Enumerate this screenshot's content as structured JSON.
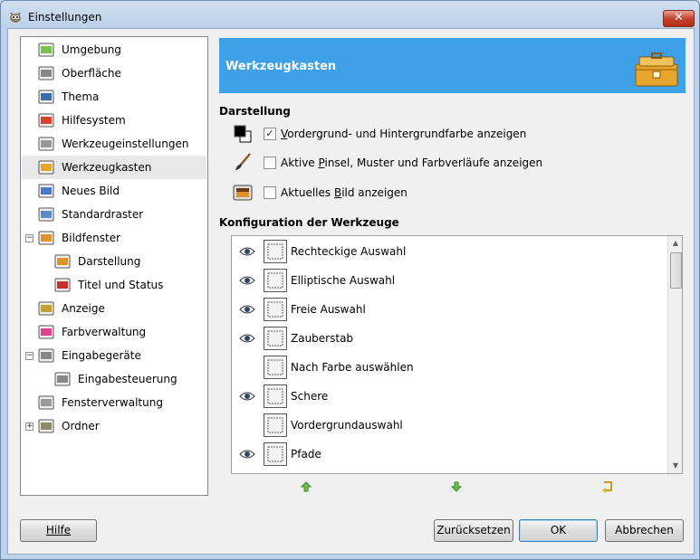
{
  "window": {
    "title": "Einstellungen",
    "close_label": "✕"
  },
  "sidebar": {
    "items": [
      {
        "label": "Umgebung",
        "icon": "environment-icon"
      },
      {
        "label": "Oberfläche",
        "icon": "interface-icon"
      },
      {
        "label": "Thema",
        "icon": "theme-icon"
      },
      {
        "label": "Hilfesystem",
        "icon": "help-system-icon"
      },
      {
        "label": "Werkzeugeinstellungen",
        "icon": "tool-options-icon"
      },
      {
        "label": "Werkzeugkasten",
        "icon": "toolbox-icon",
        "selected": true
      },
      {
        "label": "Neues Bild",
        "icon": "new-image-icon"
      },
      {
        "label": "Standardraster",
        "icon": "default-grid-icon"
      },
      {
        "label": "Bildfenster",
        "icon": "image-window-icon",
        "expander": "−"
      },
      {
        "label": "Darstellung",
        "icon": "appearance-icon",
        "child": true
      },
      {
        "label": "Titel und Status",
        "icon": "title-status-icon",
        "child": true
      },
      {
        "label": "Anzeige",
        "icon": "display-icon"
      },
      {
        "label": "Farbverwaltung",
        "icon": "color-management-icon"
      },
      {
        "label": "Eingabegeräte",
        "icon": "input-devices-icon",
        "expander": "−"
      },
      {
        "label": "Eingabesteuerung",
        "icon": "input-controllers-icon",
        "child": true
      },
      {
        "label": "Fensterverwaltung",
        "icon": "window-management-icon"
      },
      {
        "label": "Ordner",
        "icon": "folders-icon",
        "expander": "+"
      }
    ]
  },
  "banner": {
    "title": "Werkzeugkasten",
    "icon": "toolbox-large-icon"
  },
  "appearance": {
    "section_title": "Darstellung",
    "options": [
      {
        "label_pre": "",
        "label_u": "V",
        "label_post": "ordergrund- und Hintergrundfarbe anzeigen",
        "checked": true,
        "icon": "fg-bg-color-icon"
      },
      {
        "label_pre": "Aktive ",
        "label_u": "P",
        "label_post": "insel, Muster und Farbverläufe anzeigen",
        "checked": false,
        "icon": "brush-icon"
      },
      {
        "label_pre": "Aktuelles ",
        "label_u": "B",
        "label_post": "ild anzeigen",
        "checked": false,
        "icon": "active-image-icon"
      }
    ]
  },
  "tools_config": {
    "section_title": "Konfiguration der Werkzeuge",
    "tools": [
      {
        "label": "Rechteckige Auswahl",
        "visible": true,
        "icon": "rect-select-icon"
      },
      {
        "label": "Elliptische Auswahl",
        "visible": true,
        "icon": "ellipse-select-icon"
      },
      {
        "label": "Freie Auswahl",
        "visible": true,
        "icon": "free-select-icon"
      },
      {
        "label": "Zauberstab",
        "visible": true,
        "icon": "fuzzy-select-icon"
      },
      {
        "label": "Nach Farbe auswählen",
        "visible": false,
        "icon": "select-by-color-icon"
      },
      {
        "label": "Schere",
        "visible": true,
        "icon": "scissors-icon"
      },
      {
        "label": "Vordergrundauswahl",
        "visible": false,
        "icon": "foreground-select-icon"
      },
      {
        "label": "Pfade",
        "visible": true,
        "icon": "paths-icon"
      }
    ]
  },
  "buttons": {
    "help": "Hilfe",
    "reset": "Zurücksetzen",
    "ok": "OK",
    "cancel": "Abbrechen"
  },
  "colors": {
    "banner": "#3ea1e8",
    "selected_row": "#e8e8e8"
  }
}
